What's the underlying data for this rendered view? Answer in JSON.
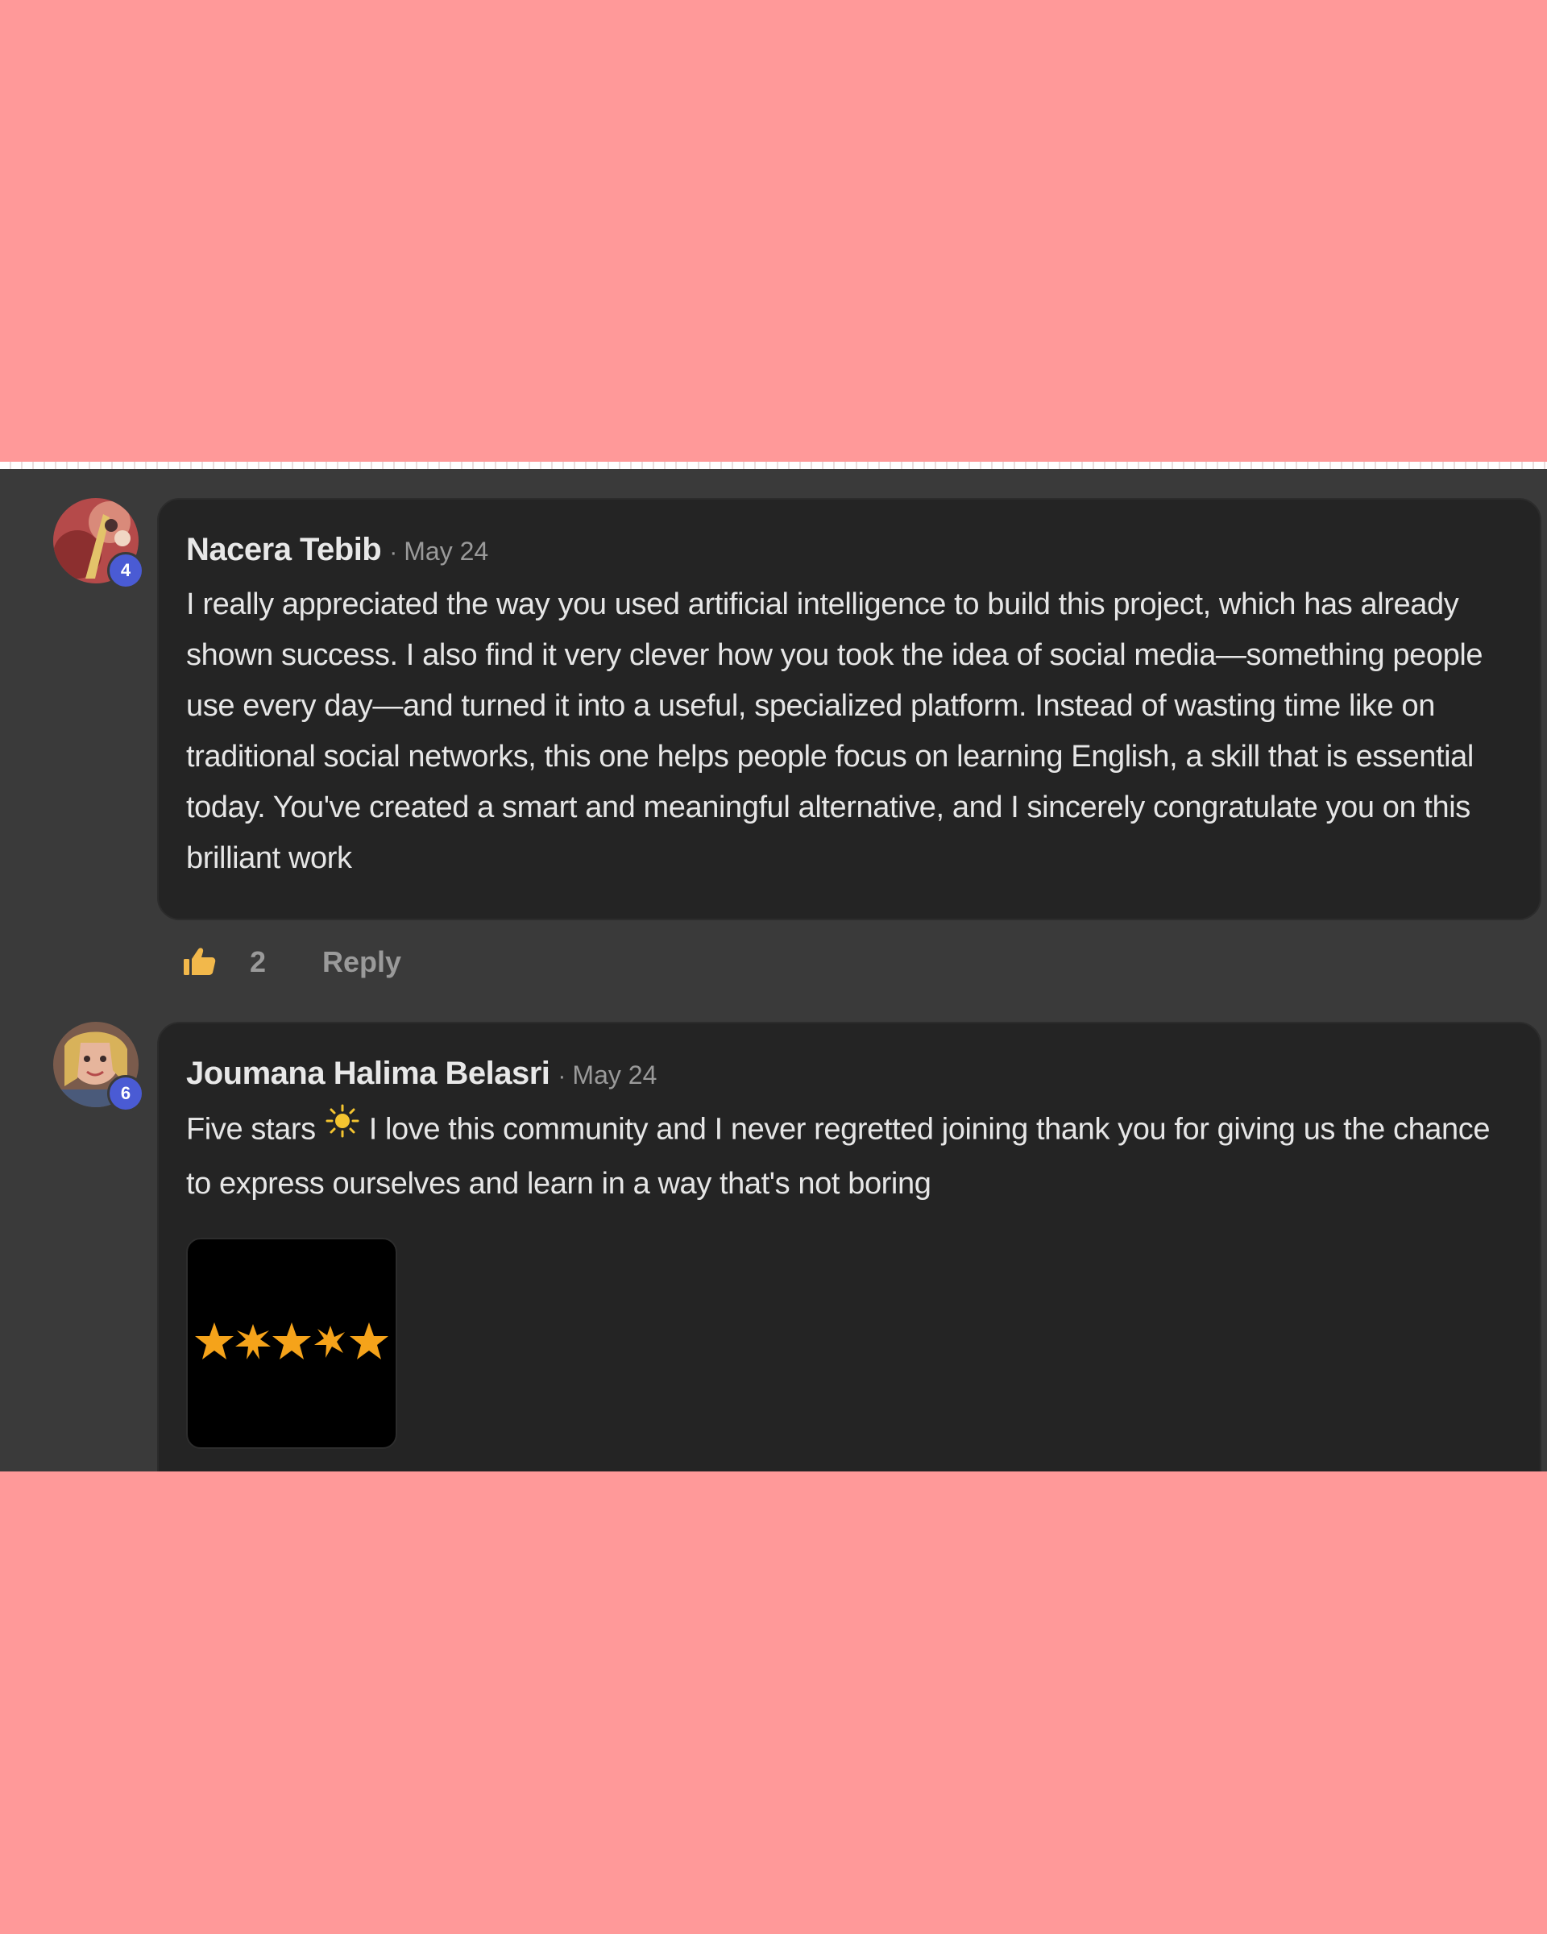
{
  "comments": [
    {
      "author": "Nacera Tebib",
      "separator": "·",
      "date": "May 24",
      "level": "4",
      "text": "I really appreciated the way you used artificial intelligence to build this project, which has already shown success. I also find it very clever how you took the idea of social media—something people use every day—and turned it into a useful, specialized platform. Instead of wasting time like on traditional social networks, this one helps people focus on learning English, a skill that is essential today. You've created a smart and meaningful alternative, and I sincerely congratulate you on this brilliant work",
      "likes": "2",
      "reply_label": "Reply",
      "like_icon": "thumbs-up-icon"
    },
    {
      "author": "Joumana Halima Belasri",
      "separator": "·",
      "date": "May 24",
      "level": "6",
      "text_before_emoji": "Five stars",
      "emoji": "sun-emoji-icon",
      "text_after_emoji": "I love this community and I never regretted joining thank you for giving us the chance to express ourselves and learn in a way that's not boring",
      "attachment": "five-stars-image",
      "rating": 5
    }
  ],
  "colors": {
    "background_pink": "#ff9999",
    "panel": "#3a3a3a",
    "bubble": "#242424",
    "badge": "#4a5bd4",
    "star": "#f5a31a",
    "muted_text": "#9a9a9a"
  }
}
